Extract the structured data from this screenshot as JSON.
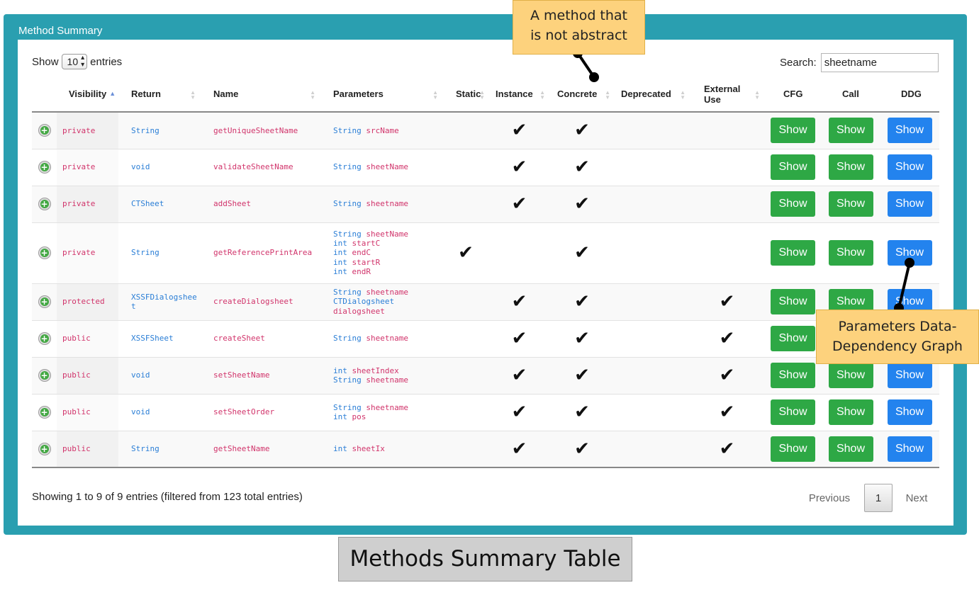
{
  "panel": {
    "title": "Method Summary"
  },
  "length": {
    "show": "Show",
    "value": "10",
    "entries": "entries"
  },
  "search": {
    "label": "Search:",
    "value": "sheetname"
  },
  "columns": [
    "Visibility",
    "Return",
    "Name",
    "Parameters",
    "Static",
    "Instance",
    "Concrete",
    "Deprecated",
    "External Use",
    "CFG",
    "Call",
    "DDG"
  ],
  "rows": [
    {
      "visibility": "private",
      "return": "String",
      "name": "getUniqueSheetName",
      "params": [
        [
          "String",
          "srcName"
        ]
      ],
      "static": false,
      "instance": true,
      "concrete": true,
      "deprecated": false,
      "external": false
    },
    {
      "visibility": "private",
      "return": "void",
      "name": "validateSheetName",
      "params": [
        [
          "String",
          "sheetName"
        ]
      ],
      "static": false,
      "instance": true,
      "concrete": true,
      "deprecated": false,
      "external": false
    },
    {
      "visibility": "private",
      "return": "CTSheet",
      "name": "addSheet",
      "params": [
        [
          "String",
          "sheetname"
        ]
      ],
      "static": false,
      "instance": true,
      "concrete": true,
      "deprecated": false,
      "external": false
    },
    {
      "visibility": "private",
      "return": "String",
      "name": "getReferencePrintArea",
      "params": [
        [
          "String",
          "sheetName"
        ],
        [
          "int",
          "startC"
        ],
        [
          "int",
          "endC"
        ],
        [
          "int",
          "startR"
        ],
        [
          "int",
          "endR"
        ]
      ],
      "static": true,
      "instance": false,
      "concrete": true,
      "deprecated": false,
      "external": false
    },
    {
      "visibility": "protected",
      "return": "XSSFDialogsheet",
      "name": "createDialogsheet",
      "params": [
        [
          "String",
          "sheetname"
        ],
        [
          "CTDialogsheet",
          "dialogsheet"
        ]
      ],
      "static": false,
      "instance": true,
      "concrete": true,
      "deprecated": false,
      "external": true
    },
    {
      "visibility": "public",
      "return": "XSSFSheet",
      "name": "createSheet",
      "params": [
        [
          "String",
          "sheetname"
        ]
      ],
      "static": false,
      "instance": true,
      "concrete": true,
      "deprecated": false,
      "external": true
    },
    {
      "visibility": "public",
      "return": "void",
      "name": "setSheetName",
      "params": [
        [
          "int",
          "sheetIndex"
        ],
        [
          "String",
          "sheetname"
        ]
      ],
      "static": false,
      "instance": true,
      "concrete": true,
      "deprecated": false,
      "external": true
    },
    {
      "visibility": "public",
      "return": "void",
      "name": "setSheetOrder",
      "params": [
        [
          "String",
          "sheetname"
        ],
        [
          "int",
          "pos"
        ]
      ],
      "static": false,
      "instance": true,
      "concrete": true,
      "deprecated": false,
      "external": true
    },
    {
      "visibility": "public",
      "return": "String",
      "name": "getSheetName",
      "params": [
        [
          "int",
          "sheetIx"
        ]
      ],
      "static": false,
      "instance": true,
      "concrete": true,
      "deprecated": false,
      "external": true
    }
  ],
  "check_glyph": "✔",
  "expand_glyph": "+",
  "button_label": "Show",
  "info": "Showing 1 to 9 of 9 entries (filtered from 123 total entries)",
  "pager": {
    "previous": "Previous",
    "page": "1",
    "next": "Next"
  },
  "annotations": {
    "top_line1": "A method that",
    "top_line2": "is not abstract",
    "right_line1": "Parameters Data-",
    "right_line2": "Dependency Graph"
  },
  "caption": "Methods Summary Table",
  "colors": {
    "panel": "#2a9fb0",
    "green_button": "#2ea845",
    "blue_button": "#2383ee",
    "callout": "#fdd27d",
    "keyword": "#d1346b",
    "type": "#2a7ed6"
  }
}
